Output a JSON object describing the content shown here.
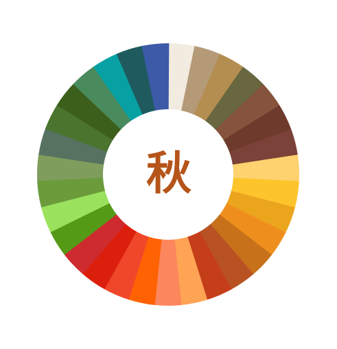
{
  "title": "秋",
  "title_color": "#b5551a",
  "background_color": "#ffffff",
  "hole_color": "#ffffff",
  "segments": [
    {
      "color": "#f2ebdf"
    },
    {
      "color": "#b59a78"
    },
    {
      "color": "#b48e50"
    },
    {
      "color": "#686740"
    },
    {
      "color": "#86533c"
    },
    {
      "color": "#6d3a2c"
    },
    {
      "color": "#7a4238"
    },
    {
      "color": "#fdd26f"
    },
    {
      "color": "#fec42c"
    },
    {
      "color": "#eba51d"
    },
    {
      "color": "#ee8f1d"
    },
    {
      "color": "#c7711a"
    },
    {
      "color": "#b95222"
    },
    {
      "color": "#c53e1a"
    },
    {
      "color": "#ffa355"
    },
    {
      "color": "#fc865d"
    },
    {
      "color": "#fe6203"
    },
    {
      "color": "#f0472a"
    },
    {
      "color": "#dc1f0d"
    },
    {
      "color": "#ce2b2f"
    },
    {
      "color": "#559a16"
    },
    {
      "color": "#9ae15d"
    },
    {
      "color": "#6b9b3a"
    },
    {
      "color": "#7f9d5d"
    },
    {
      "color": "#577261"
    },
    {
      "color": "#4b742e"
    },
    {
      "color": "#3c5f1b"
    },
    {
      "color": "#4a8b5d"
    },
    {
      "color": "#07a1a3"
    },
    {
      "color": "#1f5b5e"
    },
    {
      "color": "#3d5aa9"
    }
  ]
}
